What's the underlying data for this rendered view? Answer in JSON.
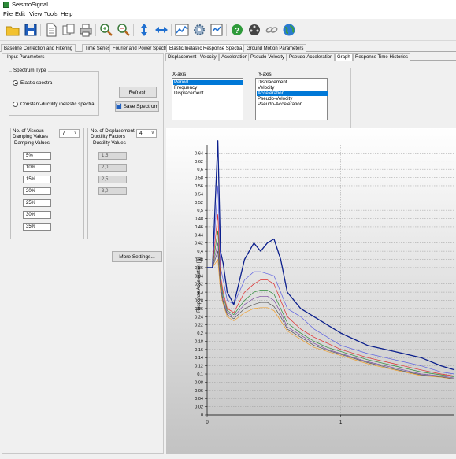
{
  "app": {
    "title": "SeismoSignal"
  },
  "menu": [
    "File",
    "Edit",
    "View",
    "Tools",
    "Help"
  ],
  "toolbar": {
    "icons": [
      "open-folder-icon",
      "save-disk-icon",
      "document-icon",
      "copy-icon",
      "print-icon",
      "zoom-in-icon",
      "zoom-out-icon",
      "vertical-arrows-icon",
      "horizontal-arrows-icon",
      "chart-icon",
      "gear-icon",
      "import-icon",
      "help-icon",
      "film-reel-icon",
      "chain-link-icon",
      "globe-icon"
    ]
  },
  "main_tabs": [
    {
      "label": "Baseline Correction and Filtering",
      "active": false
    },
    {
      "label": "Time Series",
      "active": false
    },
    {
      "label": "Fourier and Power Spectra",
      "active": false
    },
    {
      "label": "Elastic/Inelastic Response Spectra",
      "active": true
    },
    {
      "label": "Ground Motion Parameters",
      "active": false
    }
  ],
  "left": {
    "section_title": "Input Parameters",
    "spectrum_type": {
      "legend": "Spectrum Type",
      "options": [
        {
          "label": "Elastic spectra",
          "selected": true
        },
        {
          "label": "Constant-ductility inelastic spectra",
          "selected": false
        }
      ]
    },
    "refresh_label": "Refresh",
    "save_spectrum_label": "Save Spectrum",
    "damping": {
      "count_label_1": "No. of Viscous",
      "count_label_2": "Damping Values",
      "count_value": "7",
      "header": "Damping Values",
      "values": [
        "5%",
        "10%",
        "15%",
        "20%",
        "25%",
        "30%",
        "35%"
      ]
    },
    "ductility": {
      "count_label_1": "No. of Displacement",
      "count_label_2": "Ductility Factors",
      "count_value": "4",
      "header": "Ductility Values",
      "values": [
        "1,5",
        "2,0",
        "2,5",
        "3,0"
      ]
    },
    "more_settings_label": "More Settings..."
  },
  "sub_tabs": [
    {
      "label": "Displacement",
      "active": false
    },
    {
      "label": "Velocity",
      "active": false
    },
    {
      "label": "Acceleration",
      "active": false
    },
    {
      "label": "Pseudo-Velocity",
      "active": false
    },
    {
      "label": "Pseudo-Acceleration",
      "active": false
    },
    {
      "label": "Graph",
      "active": true
    },
    {
      "label": "Response Time-Histories",
      "active": false
    }
  ],
  "axis_select": {
    "x_label": "X-axis",
    "x_options": [
      {
        "label": "Period",
        "selected": true
      },
      {
        "label": "Frequency",
        "selected": false
      },
      {
        "label": "Displacement",
        "selected": false
      }
    ],
    "y_label": "Y-axis",
    "y_options": [
      {
        "label": "Displacement",
        "selected": false
      },
      {
        "label": "Velocity",
        "selected": false
      },
      {
        "label": "Acceleration",
        "selected": true
      },
      {
        "label": "Pseudo-Velocity",
        "selected": false
      },
      {
        "label": "Pseudo-Acceleration",
        "selected": false
      }
    ]
  },
  "chart_data": {
    "type": "line",
    "title": "",
    "xlabel": "",
    "ylabel": "Response Acceleration [g]",
    "xlim": [
      0,
      1.85
    ],
    "ylim": [
      0,
      0.66
    ],
    "grid": true,
    "y_ticks": [
      "0",
      "0,02",
      "0,04",
      "0,06",
      "0,08",
      "0,1",
      "0,12",
      "0,14",
      "0,16",
      "0,18",
      "0,2",
      "0,22",
      "0,24",
      "0,26",
      "0,28",
      "0,3",
      "0,32",
      "0,34",
      "0,36",
      "0,38",
      "0,4",
      "0,42",
      "0,44",
      "0,46",
      "0,48",
      "0,5",
      "0,52",
      "0,54",
      "0,56",
      "0,58",
      "0,6",
      "0,62",
      "0,64"
    ],
    "x_ticks": [
      "0",
      "1"
    ],
    "series": [
      {
        "color": "#0b1f8c",
        "x": [
          0,
          0.04,
          0.08,
          0.1,
          0.12,
          0.15,
          0.2,
          0.28,
          0.35,
          0.4,
          0.45,
          0.5,
          0.55,
          0.6,
          0.7,
          0.8,
          0.9,
          1.0,
          1.2,
          1.4,
          1.6,
          1.75,
          1.85
        ],
        "y": [
          0.36,
          0.36,
          0.67,
          0.4,
          0.37,
          0.3,
          0.27,
          0.38,
          0.42,
          0.4,
          0.42,
          0.43,
          0.38,
          0.3,
          0.26,
          0.24,
          0.22,
          0.2,
          0.17,
          0.155,
          0.14,
          0.12,
          0.11
        ]
      },
      {
        "color": "#5b5fe0",
        "x": [
          0,
          0.04,
          0.08,
          0.1,
          0.12,
          0.15,
          0.2,
          0.28,
          0.35,
          0.4,
          0.45,
          0.5,
          0.55,
          0.6,
          0.7,
          0.8,
          0.9,
          1.0,
          1.2,
          1.4,
          1.6,
          1.75,
          1.85
        ],
        "y": [
          0.36,
          0.36,
          0.56,
          0.36,
          0.33,
          0.28,
          0.27,
          0.33,
          0.35,
          0.35,
          0.345,
          0.34,
          0.3,
          0.26,
          0.24,
          0.21,
          0.19,
          0.17,
          0.15,
          0.135,
          0.12,
          0.105,
          0.1
        ]
      },
      {
        "color": "#e02b2b",
        "x": [
          0,
          0.04,
          0.08,
          0.1,
          0.12,
          0.15,
          0.2,
          0.28,
          0.35,
          0.4,
          0.45,
          0.5,
          0.55,
          0.6,
          0.7,
          0.8,
          0.9,
          1.0,
          1.2,
          1.4,
          1.6,
          1.75,
          1.85
        ],
        "y": [
          0.36,
          0.36,
          0.49,
          0.34,
          0.3,
          0.26,
          0.25,
          0.3,
          0.32,
          0.33,
          0.33,
          0.32,
          0.28,
          0.24,
          0.21,
          0.19,
          0.175,
          0.16,
          0.14,
          0.125,
          0.11,
          0.1,
          0.095
        ]
      },
      {
        "color": "#2e8b3a",
        "x": [
          0,
          0.04,
          0.08,
          0.1,
          0.12,
          0.15,
          0.2,
          0.28,
          0.35,
          0.4,
          0.45,
          0.5,
          0.55,
          0.6,
          0.7,
          0.8,
          0.9,
          1.0,
          1.2,
          1.4,
          1.6,
          1.75,
          1.85
        ],
        "y": [
          0.36,
          0.36,
          0.45,
          0.33,
          0.29,
          0.255,
          0.245,
          0.28,
          0.3,
          0.305,
          0.305,
          0.295,
          0.26,
          0.225,
          0.2,
          0.18,
          0.165,
          0.155,
          0.135,
          0.12,
          0.105,
          0.098,
          0.093
        ]
      },
      {
        "color": "#7a4aa0",
        "x": [
          0,
          0.04,
          0.08,
          0.1,
          0.12,
          0.15,
          0.2,
          0.28,
          0.35,
          0.4,
          0.45,
          0.5,
          0.55,
          0.6,
          0.7,
          0.8,
          0.9,
          1.0,
          1.2,
          1.4,
          1.6,
          1.75,
          1.85
        ],
        "y": [
          0.36,
          0.36,
          0.42,
          0.32,
          0.28,
          0.25,
          0.24,
          0.27,
          0.285,
          0.29,
          0.29,
          0.28,
          0.25,
          0.215,
          0.195,
          0.175,
          0.16,
          0.15,
          0.13,
          0.115,
          0.1,
          0.095,
          0.09
        ]
      },
      {
        "color": "#555555",
        "x": [
          0,
          0.04,
          0.08,
          0.1,
          0.12,
          0.15,
          0.2,
          0.28,
          0.35,
          0.4,
          0.45,
          0.5,
          0.55,
          0.6,
          0.7,
          0.8,
          0.9,
          1.0,
          1.2,
          1.4,
          1.6,
          1.75,
          1.85
        ],
        "y": [
          0.36,
          0.36,
          0.4,
          0.31,
          0.275,
          0.245,
          0.235,
          0.26,
          0.27,
          0.275,
          0.275,
          0.265,
          0.24,
          0.21,
          0.19,
          0.17,
          0.158,
          0.148,
          0.128,
          0.112,
          0.098,
          0.093,
          0.088
        ]
      },
      {
        "color": "#f0a030",
        "x": [
          0,
          0.04,
          0.08,
          0.1,
          0.12,
          0.15,
          0.2,
          0.28,
          0.35,
          0.4,
          0.45,
          0.5,
          0.55,
          0.6,
          0.7,
          0.8,
          0.9,
          1.0,
          1.2,
          1.4,
          1.6,
          1.75,
          1.85
        ],
        "y": [
          0.36,
          0.36,
          0.38,
          0.3,
          0.27,
          0.24,
          0.23,
          0.25,
          0.26,
          0.262,
          0.262,
          0.255,
          0.23,
          0.205,
          0.185,
          0.165,
          0.155,
          0.145,
          0.125,
          0.11,
          0.096,
          0.092,
          0.087
        ]
      }
    ]
  }
}
